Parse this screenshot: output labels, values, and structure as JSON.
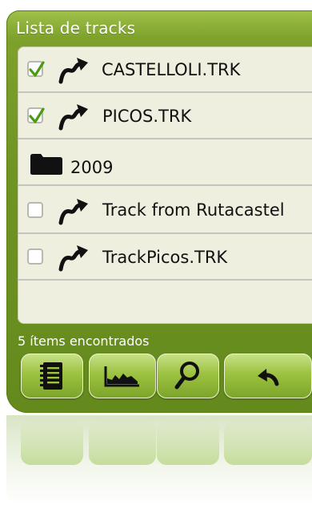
{
  "panel": {
    "title": "Lista de tracks",
    "status": "5 ítems encontrados"
  },
  "list": {
    "items": [
      {
        "type": "track",
        "label": "CASTELLOLI.TRK",
        "checked": true,
        "icon": "track-icon"
      },
      {
        "type": "track",
        "label": "PICOS.TRK",
        "checked": true,
        "icon": "track-icon"
      },
      {
        "type": "folder",
        "label": "2009",
        "icon": "folder-icon"
      },
      {
        "type": "track",
        "label": "Track from Rutacastel",
        "checked": false,
        "icon": "track-icon"
      },
      {
        "type": "track",
        "label": "TrackPicos.TRK",
        "checked": false,
        "icon": "track-icon"
      }
    ]
  },
  "toolbar": {
    "buttons": [
      {
        "name": "notes-button",
        "icon": "notebook-icon"
      },
      {
        "name": "profile-button",
        "icon": "elevation-profile-icon"
      },
      {
        "name": "search-button",
        "icon": "magnifier-icon"
      },
      {
        "name": "back-button",
        "icon": "undo-arrow-icon"
      }
    ]
  },
  "colors": {
    "panel_green": "#6f9424",
    "list_bg": "#efefe0",
    "check_green": "#4a9a12",
    "button_green": "#9dc240"
  }
}
